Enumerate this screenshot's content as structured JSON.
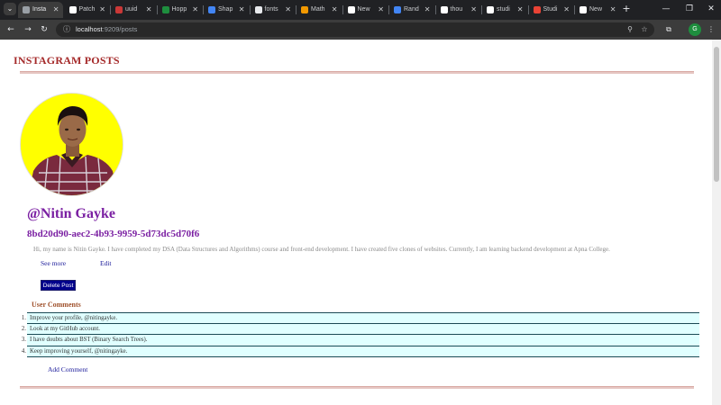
{
  "browser": {
    "tabs": [
      {
        "label": "Insta",
        "active": true,
        "favicon_color": "#9aa0a6"
      },
      {
        "label": "Patch",
        "favicon_color": "#ffffff"
      },
      {
        "label": "uuid",
        "favicon_color": "#cb3837"
      },
      {
        "label": "Hopp",
        "favicon_color": "#1e8e3e"
      },
      {
        "label": "Shap",
        "favicon_color": "#4285f4"
      },
      {
        "label": "fonts",
        "favicon_color": "#e8eaed"
      },
      {
        "label": "Math",
        "favicon_color": "#f29900"
      },
      {
        "label": "New",
        "favicon_color": "#ffffff"
      },
      {
        "label": "Rand",
        "favicon_color": "#4285f4"
      },
      {
        "label": "thou",
        "favicon_color": "#ffffff"
      },
      {
        "label": "studi",
        "favicon_color": "#ffffff"
      },
      {
        "label": "Studi",
        "favicon_color": "#ea4335"
      },
      {
        "label": "New",
        "favicon_color": "#ffffff"
      }
    ],
    "url_host": "localhost",
    "url_rest": ":9209/posts",
    "profile_initial": "G"
  },
  "page": {
    "heading": "INSTAGRAM POSTS",
    "post": {
      "username": "@Nitin Gayke",
      "id": "8bd20d90-aec2-4b93-9959-5d73dc5d70f6",
      "content": "Hi, my name is Nitin Gayke. I have completed my DSA (Data Structures and Algorithms) course and front-end development. I have created five clones of websites. Currently, I am learning backend development at Apna College.",
      "see_more": "See more",
      "edit": "Edit",
      "delete_button": "Delete Post"
    },
    "comments_title": "User Comments",
    "comments": [
      "Improve your profile, @nitingayke.",
      "Look at my GitHub account.",
      "I have doubts about BST (Binary Search Trees).",
      "Keep improving yourself, @nitingayke."
    ],
    "add_comment": "Add Comment"
  }
}
